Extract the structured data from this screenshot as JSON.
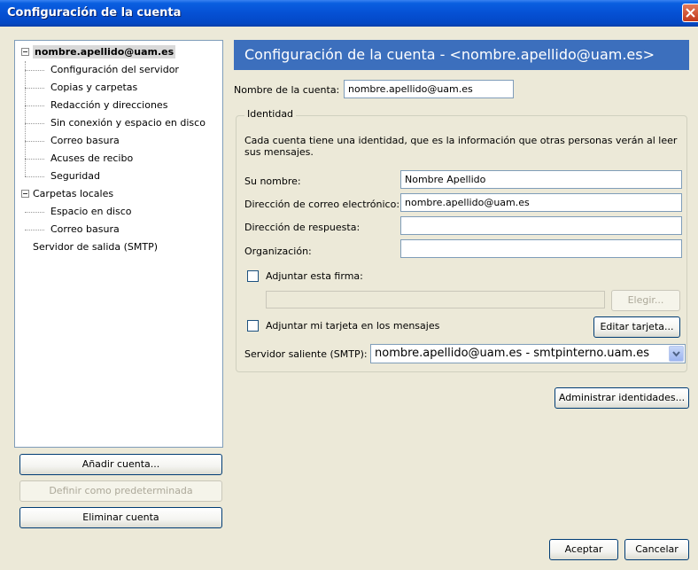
{
  "window": {
    "title": "Configuración de la cuenta"
  },
  "tree": {
    "root": "nombre.apellido@uam.es",
    "root_items": [
      "Configuración del servidor",
      "Copias y carpetas",
      "Redacción y direcciones",
      "Sin conexión y espacio en disco",
      "Correo basura",
      "Acuses de recibo",
      "Seguridad"
    ],
    "local": "Carpetas locales",
    "local_items": [
      "Espacio en disco",
      "Correo basura"
    ],
    "smtp": "Servidor de salida (SMTP)"
  },
  "left_buttons": {
    "add": "Añadir cuenta...",
    "default": "Definir como predeterminada",
    "delete": "Eliminar cuenta"
  },
  "header": {
    "title": "Configuración de la cuenta - <nombre.apellido@uam.es>"
  },
  "account": {
    "name_label": "Nombre de la cuenta:",
    "name_value": "nombre.apellido@uam.es"
  },
  "identity": {
    "group_title": "Identidad",
    "description": "Cada cuenta tiene una identidad, que es la información que otras personas verán al leer sus mensajes.",
    "your_name_label": "Su nombre:",
    "your_name_value": "Nombre Apellido",
    "email_label": "Dirección de correo electrónico:",
    "email_value": "nombre.apellido@uam.es",
    "reply_label": "Dirección de respuesta:",
    "reply_value": "",
    "org_label": "Organización:",
    "org_value": "",
    "signature_label": "Adjuntar esta firma:",
    "signature_value": "",
    "choose_button": "Elegir...",
    "vcard_label": "Adjuntar mi tarjeta en los mensajes",
    "edit_card_button": "Editar tarjeta...",
    "smtp_label": "Servidor saliente (SMTP):",
    "smtp_value": "nombre.apellido@uam.es - smtpinterno.uam.es"
  },
  "buttons": {
    "manage_identities": "Administrar identidades...",
    "accept": "Aceptar",
    "cancel": "Cancelar"
  }
}
